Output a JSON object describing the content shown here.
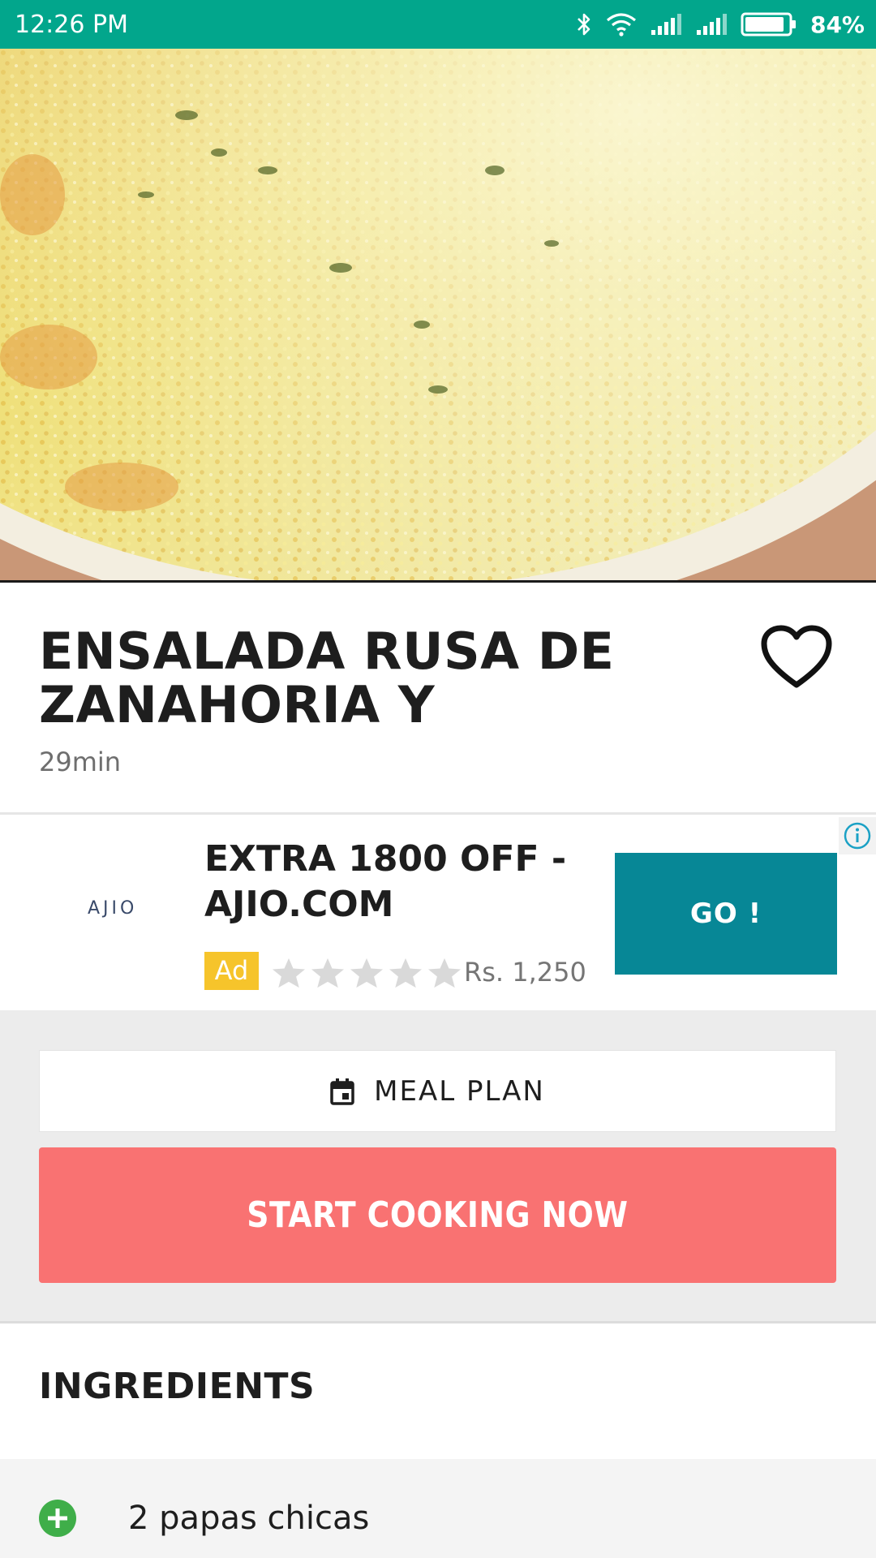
{
  "status_bar": {
    "time": "12:26 PM",
    "battery": "84%",
    "color": "#02a68c"
  },
  "hero": {
    "icon": "food-photo"
  },
  "recipe": {
    "title": "ENSALADA RUSA DE ZANAHORIA Y",
    "time": "29min",
    "favorite_icon": "heart-outline-icon"
  },
  "ad": {
    "logo_text": "AJIO",
    "headline": "EXTRA 1800 OFF - AJIO.COM",
    "badge": "Ad",
    "rating_stars": 0,
    "rating_max": 5,
    "price": "Rs. 1,250",
    "cta": "GO !",
    "cta_color": "#078796",
    "badge_color": "#f6c42b"
  },
  "actions": {
    "meal_plan_label": "MEAL PLAN",
    "meal_plan_icon": "calendar-icon",
    "start_cooking_label": "START COOKING NOW",
    "start_color": "#f97272"
  },
  "ingredients": {
    "heading": "INGREDIENTS",
    "items": [
      {
        "text": "2 papas chicas",
        "icon": "add-circle-icon",
        "icon_color": "#3fae49"
      }
    ]
  }
}
